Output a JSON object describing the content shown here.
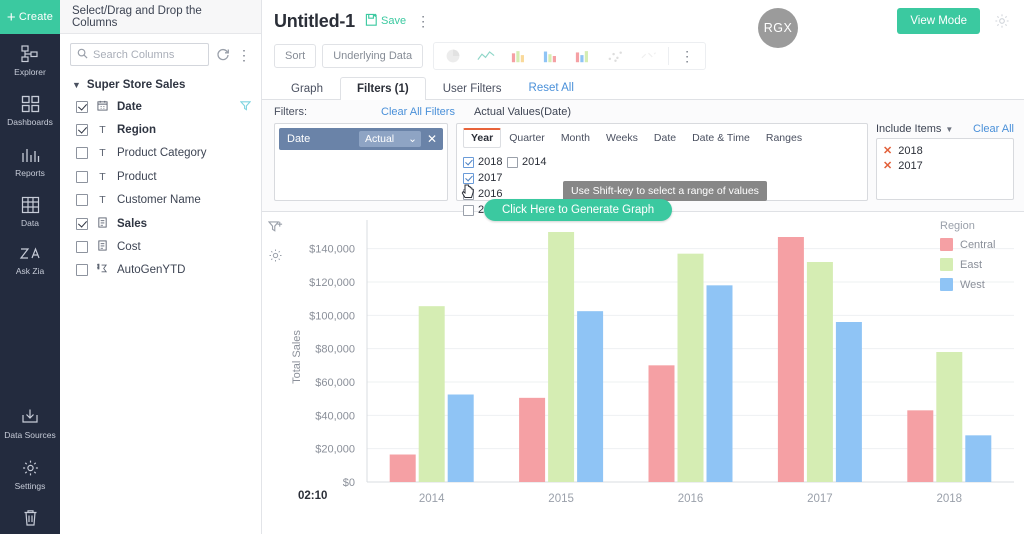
{
  "rail": {
    "create_label": "Create",
    "items": [
      {
        "label": "Explorer",
        "icon": "explorer-icon"
      },
      {
        "label": "Dashboards",
        "icon": "dashboards-icon"
      },
      {
        "label": "Reports",
        "icon": "reports-icon"
      },
      {
        "label": "Data",
        "icon": "data-icon"
      },
      {
        "label": "Ask Zia",
        "icon": "ask-zia-icon"
      }
    ],
    "bottom_items": [
      {
        "label": "Data Sources",
        "icon": "data-sources-icon"
      },
      {
        "label": "Settings",
        "icon": "settings-gear-icon"
      },
      {
        "label": "",
        "icon": "trash-icon"
      }
    ]
  },
  "columns_panel": {
    "header": "Select/Drag and Drop the Columns",
    "search_placeholder": "Search Columns",
    "search_value": "",
    "refresh_icon": "refresh-icon",
    "menu_icon": "kebab-menu-icon",
    "dataset": "Super Store Sales",
    "columns": [
      {
        "label": "Date",
        "checked": true,
        "type": "date",
        "bold": true,
        "filtered": true
      },
      {
        "label": "Region",
        "checked": true,
        "type": "text",
        "bold": true,
        "filtered": false
      },
      {
        "label": "Product Category",
        "checked": false,
        "type": "text",
        "bold": false,
        "filtered": false
      },
      {
        "label": "Product",
        "checked": false,
        "type": "text",
        "bold": false,
        "filtered": false
      },
      {
        "label": "Customer Name",
        "checked": false,
        "type": "text",
        "bold": false,
        "filtered": false
      },
      {
        "label": "Sales",
        "checked": true,
        "type": "number",
        "bold": true,
        "filtered": false
      },
      {
        "label": "Cost",
        "checked": false,
        "type": "number",
        "bold": false,
        "filtered": false
      },
      {
        "label": "AutoGenYTD",
        "checked": false,
        "type": "formula",
        "bold": false,
        "filtered": false
      }
    ]
  },
  "topbar": {
    "title": "Untitled-1",
    "save_label": "Save",
    "save_icon": "save-icon",
    "more_icon": "kebab-menu-icon",
    "avatar_initials": "RGX",
    "view_mode_label": "View Mode",
    "settings_icon": "gear-icon"
  },
  "chart_toolbar": {
    "sort_label": "Sort",
    "underlying_data_label": "Underlying Data",
    "chart_type_icons": [
      "pie-chart-icon",
      "line-chart-icon",
      "bar-chart-icon",
      "column-chart-icon",
      "stacked-bar-icon",
      "scatter-chart-icon",
      "more-charts-icon"
    ],
    "overflow_icon": "kebab-menu-icon"
  },
  "tabs": {
    "items": [
      {
        "label": "Graph",
        "active": false
      },
      {
        "label": "Filters (1)",
        "active": true
      },
      {
        "label": "User Filters",
        "active": false
      }
    ],
    "reset_all_label": "Reset All"
  },
  "filter_panel": {
    "filters_label": "Filters:",
    "clear_all_filters_label": "Clear All Filters",
    "actual_values_title": "Actual Values(Date)",
    "chip": {
      "name": "Date",
      "mode": "Actual",
      "close_icon": "close-icon",
      "caret_icon": "chevron-down-icon"
    },
    "subtabs": [
      {
        "label": "Year",
        "active": true
      },
      {
        "label": "Quarter",
        "active": false
      },
      {
        "label": "Month",
        "active": false
      },
      {
        "label": "Weeks",
        "active": false
      },
      {
        "label": "Date",
        "active": false
      },
      {
        "label": "Date & Time",
        "active": false
      },
      {
        "label": "Ranges",
        "active": false
      }
    ],
    "years_col1": [
      {
        "label": "2018",
        "checked": true
      },
      {
        "label": "2017",
        "checked": true
      },
      {
        "label": "2016",
        "checked": false
      },
      {
        "label": "2015",
        "checked": false
      }
    ],
    "years_col2": [
      {
        "label": "2014",
        "checked": false
      }
    ],
    "tooltip": "Use Shift-key to select a range of values",
    "include_items_label": "Include Items",
    "include_caret_icon": "chevron-down-icon",
    "clear_all_label": "Clear All",
    "included": [
      "2018",
      "2017"
    ],
    "generate_button_label": "Click Here to Generate Graph"
  },
  "chart_side": {
    "add_filter_icon": "funnel-plus-icon",
    "chart_settings_icon": "gear-icon"
  },
  "status": {
    "clock": "02:10"
  },
  "chart_data": {
    "type": "bar",
    "title": "",
    "xlabel": "",
    "ylabel": "Total Sales",
    "categories": [
      "2014",
      "2015",
      "2016",
      "2017",
      "2018"
    ],
    "ylim": [
      0,
      150000
    ],
    "yticks": [
      0,
      20000,
      40000,
      60000,
      80000,
      100000,
      120000,
      140000
    ],
    "ytick_labels": [
      "$0",
      "$20,000",
      "$40,000",
      "$60,000",
      "$80,000",
      "$100,000",
      "$120,000",
      "$140,000"
    ],
    "grid": true,
    "legend_title": "Region",
    "legend_position": "right",
    "series": [
      {
        "name": "Central",
        "color": "#f5a0a4",
        "values": [
          16500,
          50500,
          70000,
          147000,
          43000
        ]
      },
      {
        "name": "East",
        "color": "#d5edb3",
        "values": [
          105500,
          150000,
          137000,
          132000,
          78000
        ]
      },
      {
        "name": "West",
        "color": "#8fc4f5",
        "values": [
          52500,
          102500,
          118000,
          96000,
          28000
        ]
      }
    ]
  }
}
